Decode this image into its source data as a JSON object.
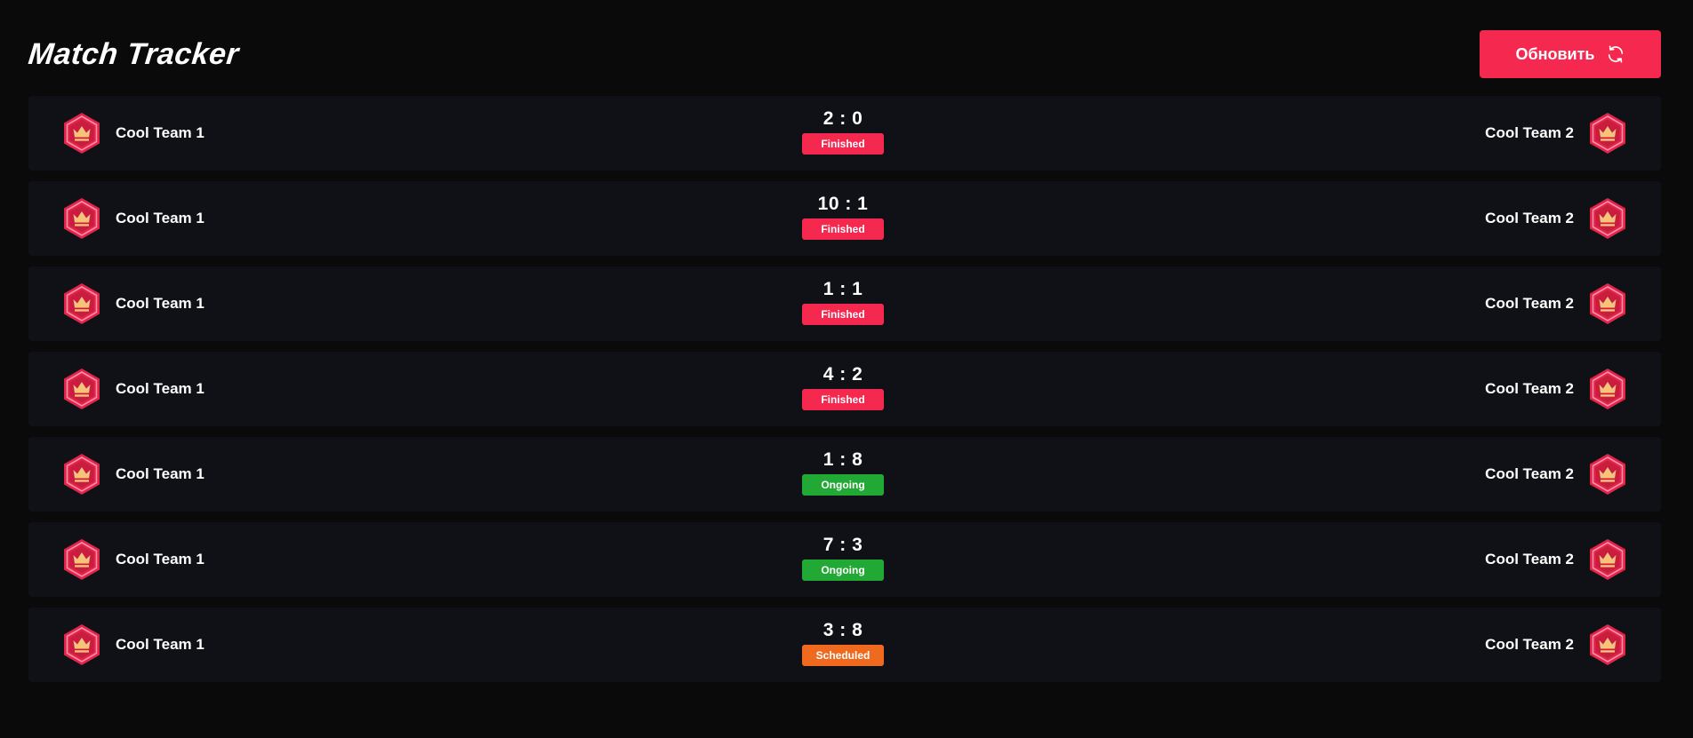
{
  "header": {
    "title": "Match Tracker",
    "refresh_label": "Обновить"
  },
  "colors": {
    "background": "#0a0a0a",
    "card": "#0f1116",
    "accent": "#f5294f",
    "finished": "#f5294f",
    "ongoing": "#22a834",
    "scheduled": "#ef6a1f"
  },
  "icons": {
    "refresh": "refresh-icon",
    "team_logo": "crown-shield-icon"
  },
  "matches": [
    {
      "home": "Cool Team 1",
      "score": "2 : 0",
      "status": "Finished",
      "status_kind": "finished",
      "away": "Cool Team 2"
    },
    {
      "home": "Cool Team 1",
      "score": "10 : 1",
      "status": "Finished",
      "status_kind": "finished",
      "away": "Cool Team 2"
    },
    {
      "home": "Cool Team 1",
      "score": "1 : 1",
      "status": "Finished",
      "status_kind": "finished",
      "away": "Cool Team 2"
    },
    {
      "home": "Cool Team 1",
      "score": "4 : 2",
      "status": "Finished",
      "status_kind": "finished",
      "away": "Cool Team 2"
    },
    {
      "home": "Cool Team 1",
      "score": "1 : 8",
      "status": "Ongoing",
      "status_kind": "ongoing",
      "away": "Cool Team 2"
    },
    {
      "home": "Cool Team 1",
      "score": "7 : 3",
      "status": "Ongoing",
      "status_kind": "ongoing",
      "away": "Cool Team 2"
    },
    {
      "home": "Cool Team 1",
      "score": "3 : 8",
      "status": "Scheduled",
      "status_kind": "scheduled",
      "away": "Cool Team 2"
    }
  ]
}
